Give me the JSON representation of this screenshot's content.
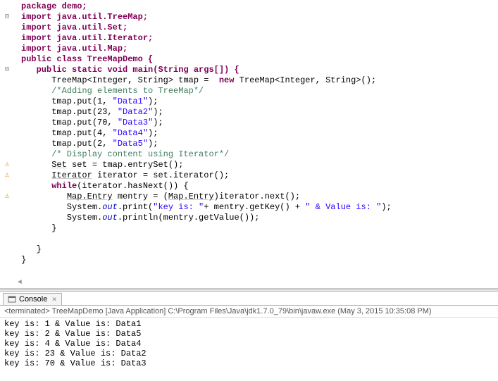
{
  "code": {
    "package": "package demo;",
    "imports": [
      "import java.util.TreeMap;",
      "import java.util.Set;",
      "import java.util.Iterator;",
      "import java.util.Map;"
    ],
    "class_decl": "public class TreeMapDemo {",
    "main_decl": "public static void main(String args[]) {",
    "tmap_decl_pre": "      TreeMap<Integer, String> tmap =  ",
    "tmap_decl_new": "new",
    "tmap_decl_post": " TreeMap<Integer, String>();",
    "comment_add": "      /*Adding elements to TreeMap*/",
    "put1_a": "      tmap.put(1, ",
    "put1_b": "\"Data1\"",
    "put1_c": ");",
    "put2_a": "      tmap.put(23, ",
    "put2_b": "\"Data2\"",
    "put2_c": ");",
    "put3_a": "      tmap.put(70, ",
    "put3_b": "\"Data3\"",
    "put3_c": ");",
    "put4_a": "      tmap.put(4, ",
    "put4_b": "\"Data4\"",
    "put4_c": ");",
    "put5_a": "      tmap.put(2, ",
    "put5_b": "\"Data5\"",
    "put5_c": ");",
    "comment_disp": "      /* Display content using Iterator*/",
    "set_line_a": "      ",
    "set_line_b": "Set",
    "set_line_c": " set = tmap.entrySet();",
    "iter_line_a": "      ",
    "iter_line_b": "Iterator",
    "iter_line_c": " iterator = set.iterator();",
    "while_a": "      ",
    "while_b": "while",
    "while_c": "(iterator.hasNext()) {",
    "mentry_a": "         ",
    "mentry_b": "Map.Entry",
    "mentry_c": " mentry = (",
    "mentry_d": "Map.Entry",
    "mentry_e": ")iterator.next();",
    "print_a": "         System.",
    "print_b": "out",
    "print_c": ".print(",
    "print_d": "\"key is: \"",
    "print_e": "+ mentry.getKey() + ",
    "print_f": "\" & Value is: \"",
    "print_g": ");",
    "println_a": "         System.",
    "println_b": "out",
    "println_c": ".println(mentry.getValue());",
    "close_while": "      }",
    "close_main": "   }",
    "close_class": "}"
  },
  "console": {
    "tab_label": "Console",
    "header_prefix": "<terminated>",
    "header_text": " TreeMapDemo [Java Application] C:\\Program Files\\Java\\jdk1.7.0_79\\bin\\javaw.exe (May 3, 2015 10:35:08 PM)",
    "lines": [
      "key is: 1 & Value is: Data1",
      "key is: 2 & Value is: Data5",
      "key is: 4 & Value is: Data4",
      "key is: 23 & Value is: Data2",
      "key is: 70 & Value is: Data3"
    ]
  }
}
